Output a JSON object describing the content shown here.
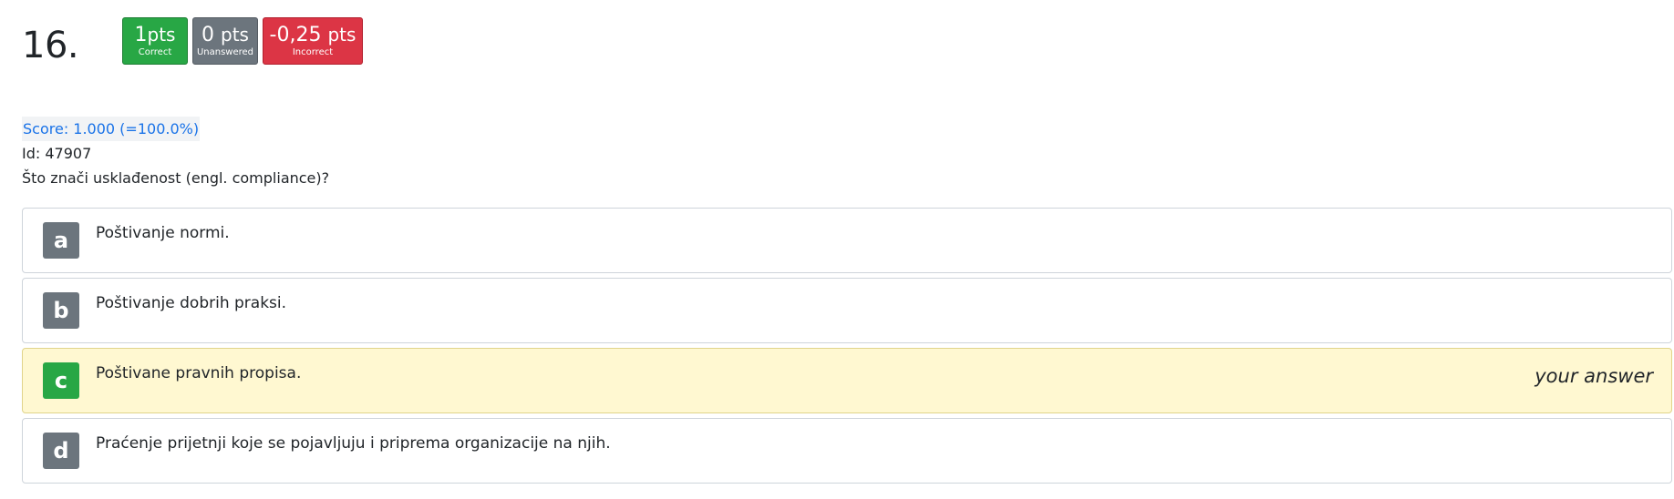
{
  "question": {
    "number": "16.",
    "score": "Score: 1.000 (=100.0%)",
    "id": "Id: 47907",
    "text": "Što znači usklađenost (engl. compliance)?"
  },
  "badges": {
    "correct": {
      "points": "1",
      "unit": "pts",
      "label": "Correct",
      "color": "#28a745"
    },
    "unanswered": {
      "points": "0",
      "unit": "pts",
      "label": "Unanswered",
      "color": "#6c757d"
    },
    "incorrect": {
      "points": "-0,25",
      "unit": "pts",
      "label": "Incorrect",
      "color": "#dc3545"
    }
  },
  "answers": [
    {
      "letter": "a",
      "text": "Poštivanje normi."
    },
    {
      "letter": "b",
      "text": "Poštivanje dobrih praksi."
    },
    {
      "letter": "c",
      "text": "Poštivane pravnih propisa.",
      "tag": "your answer"
    },
    {
      "letter": "d",
      "text": "Praćenje prijetnji koje se pojavljuju i priprema organizacije na njih."
    }
  ]
}
